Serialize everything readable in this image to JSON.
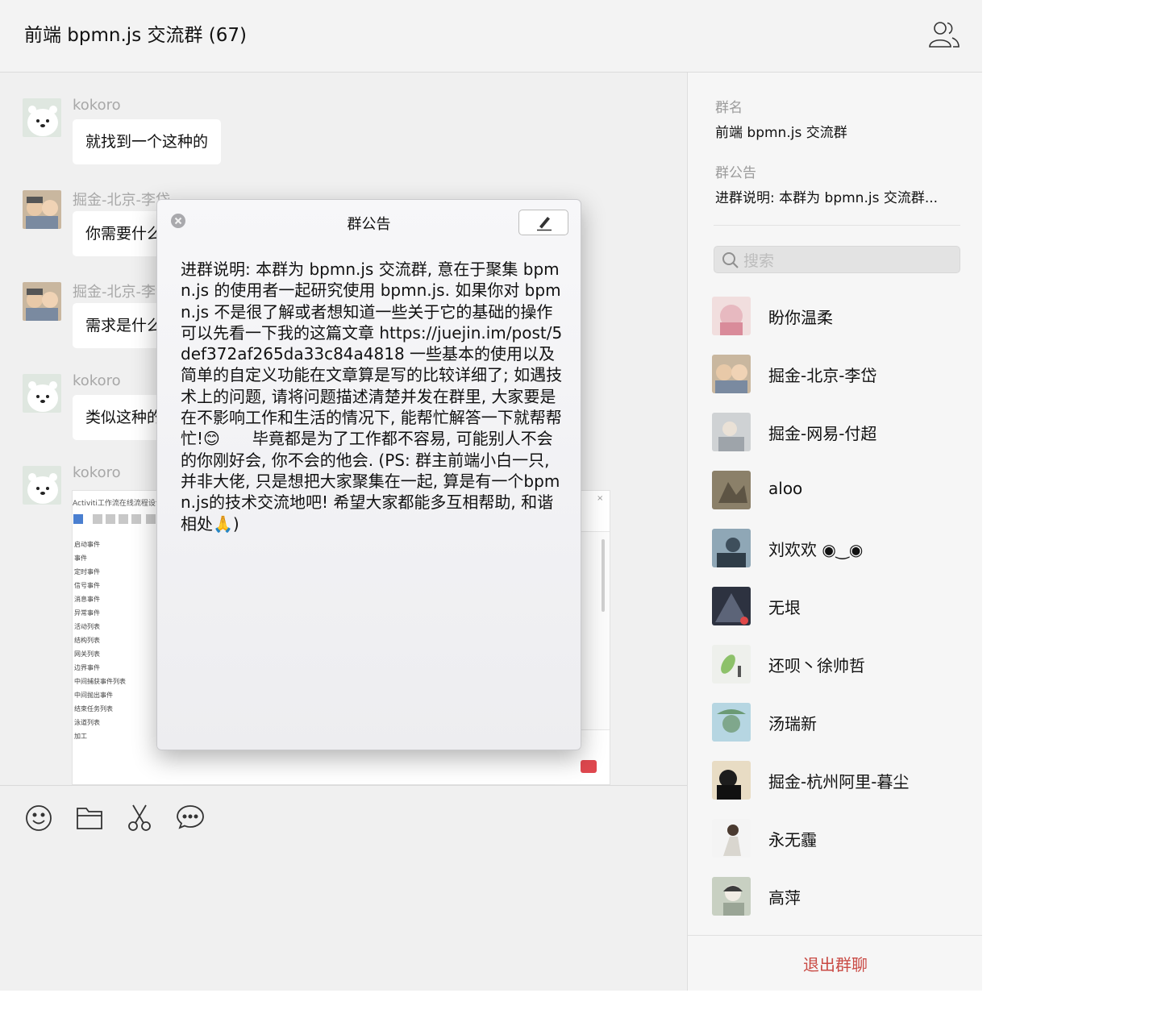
{
  "window": {
    "title": "前端 bpmn.js 交流群 (67)"
  },
  "chat": {
    "messages": [
      {
        "sender": "kokoro",
        "text": "就找到一个这种的"
      },
      {
        "sender": "掘金-北京-李岱",
        "text": "你需要什么"
      },
      {
        "sender": "掘金-北京-李岱",
        "text": "需求是什么"
      },
      {
        "sender": "kokoro",
        "text": "类似这种的"
      },
      {
        "sender": "kokoro",
        "text": ""
      }
    ],
    "screenshot": {
      "title": "Activiti工作流在线流程设计编辑",
      "tree": [
        "启动事件",
        "事件",
        "定时事件",
        "信号事件",
        "消息事件",
        "异常事件",
        "活动列表",
        "结构列表",
        "网关列表",
        "边界事件",
        "中间捕获事件列表",
        "中间抛出事件",
        "结束任务列表",
        "泳道列表",
        "加工"
      ]
    }
  },
  "composer": {
    "tools": [
      "emoji-icon",
      "folder-icon",
      "scissors-icon",
      "chat-bubble-icon"
    ]
  },
  "notice_popup": {
    "title": "群公告",
    "body": "进群说明: 本群为 bpmn.js 交流群, 意在于聚集 bpmn.js 的使用者一起研究使用 bpmn.js. 如果你对 bpmn.js 不是很了解或者想知道一些关于它的基础的操作可以先看一下我的这篇文章 https://juejin.im/post/5def372af265da33c84a4818 一些基本的使用以及简单的自定义功能在文章算是写的比较详细了; 如遇技术上的问题, 请将问题描述清楚并发在群里, 大家要是在不影响工作和生活的情况下, 能帮忙解答一下就帮帮忙!😊　　毕竟都是为了工作都不容易, 可能别人不会的你刚好会, 你不会的他会. (PS: 群主前端小白一只, 并非大佬, 只是想把大家聚集在一起, 算是有一个bpmn.js的技术交流地吧! 希望大家都能多互相帮助, 和谐相处🙏)"
  },
  "sidebar": {
    "group_name_label": "群名",
    "group_name": "前端 bpmn.js 交流群",
    "notice_label": "群公告",
    "notice_preview": "进群说明: 本群为 bpmn.js 交流群...",
    "search_placeholder": "搜索",
    "members": [
      "盼你温柔",
      "掘金-北京-李岱",
      "掘金-网易-付超",
      "aloo",
      "刘欢欢 ◉‿◉",
      "无垠",
      "还呗丶徐帅哲",
      "汤瑞新",
      "掘金-杭州阿里-暮尘",
      "永无霾",
      "高萍"
    ],
    "exit_label": "退出群聊"
  },
  "colors": {
    "exit": "#c94a44",
    "bubble": "#ffffff",
    "panel": "#f6f6f6"
  }
}
